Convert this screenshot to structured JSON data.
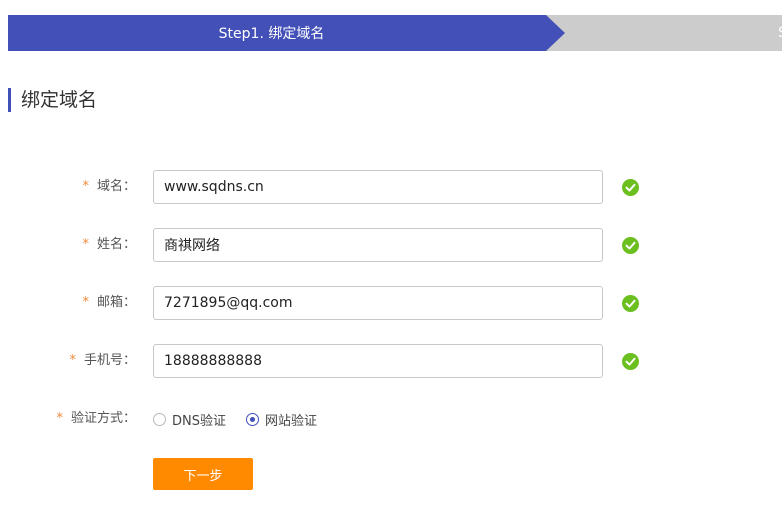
{
  "steps": {
    "active_label": "Step1. 绑定域名",
    "next_label": "S"
  },
  "section": {
    "title": "绑定域名"
  },
  "form": {
    "required_mark": "*",
    "domain": {
      "label": "域名：",
      "value": "www.sqdns.cn"
    },
    "name": {
      "label": "姓名：",
      "value": "商祺网络"
    },
    "email": {
      "label": "邮箱：",
      "value": "7271895@qq.com"
    },
    "phone": {
      "label": "手机号：",
      "value": "18888888888"
    },
    "verify": {
      "label": "验证方式：",
      "options": [
        "DNS验证",
        "网站验证"
      ],
      "selected": "网站验证"
    },
    "next_button": "下一步"
  },
  "colors": {
    "primary": "#4350b8",
    "step_inactive": "#cccccc",
    "button": "#ff8a00",
    "success": "#6bbf1f",
    "required": "#f08a3c"
  }
}
